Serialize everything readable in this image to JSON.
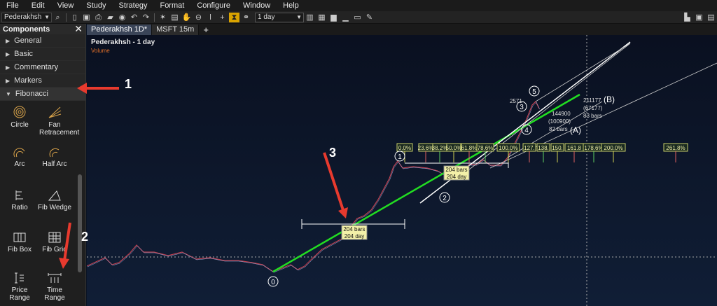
{
  "menu": [
    "File",
    "Edit",
    "View",
    "Study",
    "Strategy",
    "Format",
    "Configure",
    "Window",
    "Help"
  ],
  "toolbar": {
    "symbol": "Pederakhsh",
    "interval": "1 day"
  },
  "sidebar": {
    "title": "Components",
    "categories": [
      "General",
      "Basic",
      "Commentary",
      "Markers",
      "Fibonacci"
    ],
    "tools": [
      {
        "label": "Circle",
        "icon": "fib-circle-icon"
      },
      {
        "label": "Fan Retracement",
        "icon": "fan-retracement-icon"
      },
      {
        "label": "Arc",
        "icon": "arc-icon"
      },
      {
        "label": "Half Arc",
        "icon": "half-arc-icon"
      },
      {
        "label": "Ratio",
        "icon": "ratio-icon"
      },
      {
        "label": "Fib Wedge",
        "icon": "fib-wedge-icon"
      },
      {
        "label": "Fib Box",
        "icon": "fib-box-icon"
      },
      {
        "label": "Fib Grid",
        "icon": "fib-grid-icon"
      },
      {
        "label": "Price Range",
        "icon": "price-range-icon"
      },
      {
        "label": "Time Range",
        "icon": "time-range-icon"
      }
    ]
  },
  "tabs": [
    "Pederakhsh 1D*",
    "MSFT 15m"
  ],
  "chart": {
    "title": "Pederakhsh - 1 day",
    "subtitle": "Volume",
    "fib_levels": [
      "0.0%",
      "23.6%",
      "38.2%",
      "50.0%",
      "61.8%",
      "78.6%",
      "100.0%",
      "127.",
      "138.",
      "150.",
      "161.8",
      "178.6%",
      "200.0%",
      "261.8%"
    ],
    "range_box_1": {
      "line1": "204 bars",
      "line2": "204 day"
    },
    "range_box_2": {
      "line1": "204 bars",
      "line2": "204 day"
    },
    "wave_labels": [
      "0",
      "1",
      "2",
      "3",
      "4",
      "5",
      "(A)",
      "(B)"
    ],
    "top_labels": {
      "a": "2571",
      "b": "211177",
      "c": "(67177)",
      "d": "83 bars",
      "e": "144900",
      "f": "(100900)",
      "g": "82 bars"
    },
    "annotations": [
      "1",
      "2",
      "3"
    ],
    "colors": {
      "accent_green": "#22dd22",
      "arrow_red": "#e83a2e",
      "bull": "#e03030",
      "bear": "#9ab0e0"
    }
  }
}
